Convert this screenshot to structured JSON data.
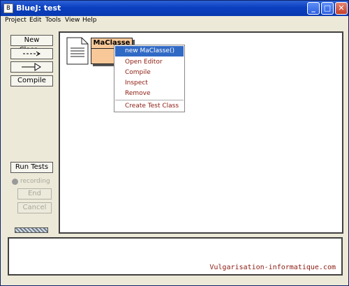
{
  "window": {
    "title": "BlueJ:  test",
    "app_icon": "bluej-icon",
    "controls": [
      "minimize-icon",
      "maximize-icon",
      "close-icon"
    ]
  },
  "menubar": {
    "items": [
      "Project",
      "Edit",
      "Tools",
      "View",
      "Help"
    ]
  },
  "toolbar": {
    "new_class": "New Class...",
    "dependency_arrow": "dashed-arrow-icon",
    "inheritance_arrow": "inheritance-arrow-icon",
    "compile": "Compile"
  },
  "testing": {
    "run_tests": "Run Tests",
    "recording": "recording",
    "end": "End",
    "cancel": "Cancel"
  },
  "diagram": {
    "readme_icon": "document-icon",
    "class_name": "MaClasse"
  },
  "context_menu": {
    "items": [
      "new MaClasse()",
      "Open Editor",
      "Compile",
      "Inspect",
      "Remove",
      "Create Test Class"
    ],
    "highlighted_index": 0
  },
  "terminal": {
    "watermark": "Vulgarisation-informatique.com"
  },
  "colors": {
    "window_bg": "#ece9d8",
    "class_fill": "#f8c898",
    "menu_highlight": "#316ac5",
    "menu_text": "#8b1a10",
    "titlebar": "#0a3fbf"
  }
}
